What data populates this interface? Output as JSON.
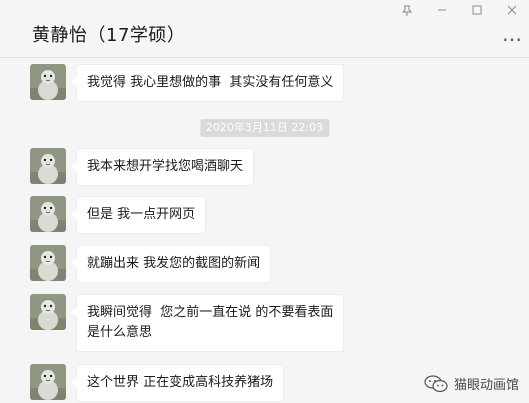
{
  "window": {
    "controls": {
      "pin_icon": "⊼",
      "minimize_icon": "—",
      "maximize_icon": "☐",
      "close_icon": "✕"
    }
  },
  "header": {
    "title": "黄静怡（17学硕）",
    "more_icon": "…"
  },
  "messages": [
    {
      "text": "我觉得 我心里想做的事  其实没有任何意义"
    },
    {
      "text": "我本来想开学找您喝酒聊天"
    },
    {
      "text": "但是 我一点开网页"
    },
    {
      "text": "就蹦出来 我发您的截图的新闻"
    },
    {
      "text": "我瞬间觉得  您之前一直在说 的不要看表面\n是什么意思"
    },
    {
      "text": "这个世界 正在变成高科技养猪场"
    }
  ],
  "timestamp": "2020年3月11日 22:03",
  "watermark": {
    "text": "猫眼动画馆"
  }
}
